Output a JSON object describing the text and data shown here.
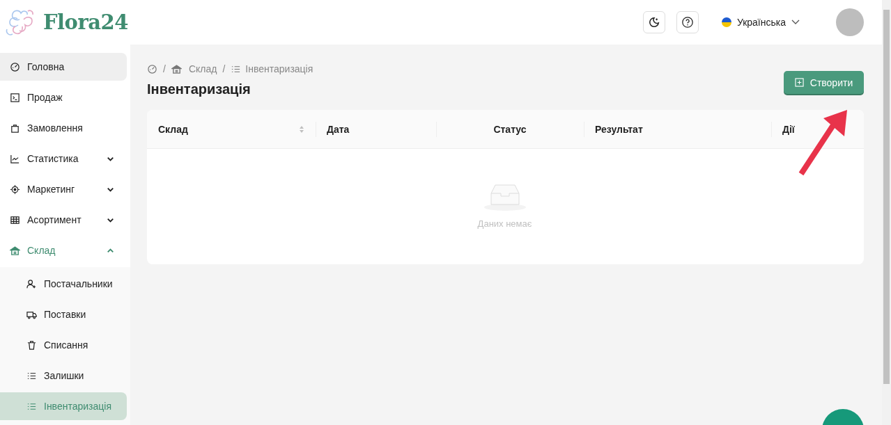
{
  "logo": {
    "text": "Flora24"
  },
  "header": {
    "language": "Українська"
  },
  "sidebar": {
    "items": [
      {
        "label": "Головна",
        "hovered": true,
        "selected": false
      },
      {
        "label": "Продаж",
        "hovered": false,
        "selected": false
      },
      {
        "label": "Замовлення",
        "hovered": false,
        "selected": false
      },
      {
        "label": "Статистика",
        "hovered": false,
        "selected": false,
        "expanded": false
      },
      {
        "label": "Маркетинг",
        "hovered": false,
        "selected": false,
        "expanded": false
      },
      {
        "label": "Асортимент",
        "hovered": false,
        "selected": false,
        "expanded": false
      },
      {
        "label": "Склад",
        "hovered": false,
        "selected": true,
        "expanded": true,
        "children": [
          {
            "label": "Постачальники",
            "selected": false
          },
          {
            "label": "Поставки",
            "selected": false
          },
          {
            "label": "Списання",
            "selected": false
          },
          {
            "label": "Залишки",
            "selected": false
          },
          {
            "label": "Інвентаризація",
            "selected": true
          }
        ]
      }
    ]
  },
  "breadcrumb": [
    {
      "separator": "/",
      "label": "Склад"
    },
    {
      "separator": "/",
      "label": "Інвентаризація"
    }
  ],
  "page_title": "Інвентаризація",
  "create_button": "Створити",
  "table": {
    "columns": [
      {
        "label": "Склад",
        "sortable": true
      },
      {
        "label": "Дата",
        "sortable": false
      },
      {
        "label": "Статус",
        "sortable": false
      },
      {
        "label": "Результат",
        "sortable": false
      },
      {
        "label": "Дії",
        "sortable": false
      }
    ],
    "empty_text": "Даних немає"
  }
}
